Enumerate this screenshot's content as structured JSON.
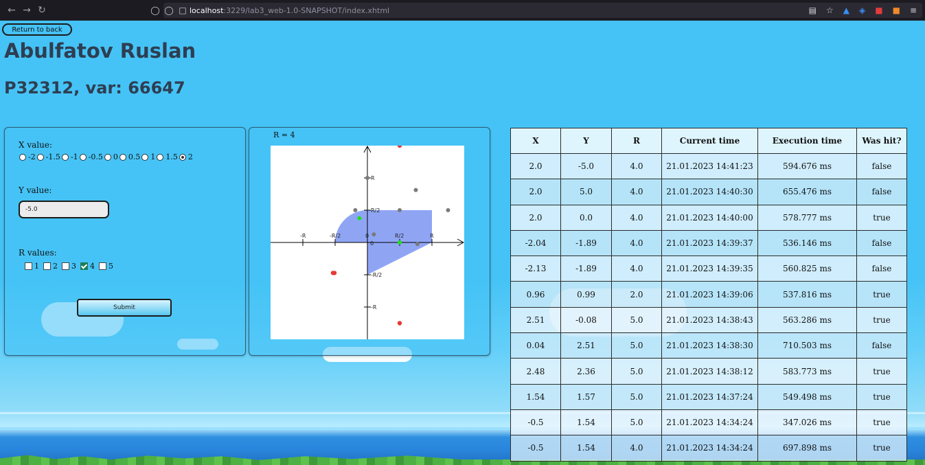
{
  "browser": {
    "url_host": "localhost",
    "url_path": ":3229/lab3_web-1.0-SNAPSHOT/index.xhtml"
  },
  "page": {
    "back_button": "Return to back",
    "author": "Abulfatov Ruslan",
    "group": "P32312, var: 66647"
  },
  "form": {
    "x_label": "X value:",
    "x_options": [
      "-2",
      "-1.5",
      "-1",
      "-0.5",
      "0",
      "0.5",
      "1",
      "1.5",
      "2"
    ],
    "x_selected": "2",
    "y_label": "Y value:",
    "y_value": "-5.0",
    "r_label": "R values:",
    "r_options": [
      "1",
      "2",
      "3",
      "4",
      "5"
    ],
    "r_checked": [
      "4"
    ],
    "submit_label": "Submit"
  },
  "graph": {
    "r_caption": "R = 4",
    "axis_labels": {
      "neg_r": "-R",
      "neg_half": "-R/2",
      "zero_x": "0",
      "half": "R/2",
      "r": "R",
      "y_r": "R",
      "y_half": "R/2",
      "zero_y": "0",
      "y_neg_half": "-R/2",
      "y_neg_r": "-R"
    },
    "area_color": "#8fa5f4",
    "points_r": 4,
    "points": [
      {
        "x": 2.0,
        "y": 6.0,
        "color": "red"
      },
      {
        "x": 0.0,
        "y": 4.0,
        "color": "gray"
      },
      {
        "x": 3.0,
        "y": 3.25,
        "color": "gray"
      },
      {
        "x": -0.75,
        "y": 2.0,
        "color": "gray"
      },
      {
        "x": 2.0,
        "y": 2.0,
        "color": "gray"
      },
      {
        "x": 5.0,
        "y": 2.0,
        "color": "gray"
      },
      {
        "x": -0.5,
        "y": 1.5,
        "color": "green"
      },
      {
        "x": 0.4,
        "y": 0.5,
        "color": "gray"
      },
      {
        "x": 2.0,
        "y": 0.0,
        "color": "green"
      },
      {
        "x": 3.1,
        "y": -0.1,
        "color": "gray"
      },
      {
        "x": -2.13,
        "y": -1.89,
        "color": "red"
      },
      {
        "x": -2.04,
        "y": -1.89,
        "color": "red"
      },
      {
        "x": 2.0,
        "y": -5.0,
        "color": "red"
      }
    ],
    "colors": {
      "red": "#e53935",
      "gray": "#7a7a7a",
      "green": "#22dd22"
    }
  },
  "table": {
    "headers": [
      "X",
      "Y",
      "R",
      "Current time",
      "Execution time",
      "Was hit?"
    ],
    "rows": [
      [
        "2.0",
        "-5.0",
        "4.0",
        "21.01.2023 14:41:23",
        "594.676 ms",
        "false"
      ],
      [
        "2.0",
        "5.0",
        "4.0",
        "21.01.2023 14:40:30",
        "655.476 ms",
        "false"
      ],
      [
        "2.0",
        "0.0",
        "4.0",
        "21.01.2023 14:40:00",
        "578.777 ms",
        "true"
      ],
      [
        "-2.04",
        "-1.89",
        "4.0",
        "21.01.2023 14:39:37",
        "536.146 ms",
        "false"
      ],
      [
        "-2.13",
        "-1.89",
        "4.0",
        "21.01.2023 14:39:35",
        "560.825 ms",
        "false"
      ],
      [
        "0.96",
        "0.99",
        "2.0",
        "21.01.2023 14:39:06",
        "537.816 ms",
        "true"
      ],
      [
        "2.51",
        "-0.08",
        "5.0",
        "21.01.2023 14:38:43",
        "563.286 ms",
        "true"
      ],
      [
        "0.04",
        "2.51",
        "5.0",
        "21.01.2023 14:38:30",
        "710.503 ms",
        "false"
      ],
      [
        "2.48",
        "2.36",
        "5.0",
        "21.01.2023 14:38:12",
        "583.773 ms",
        "true"
      ],
      [
        "1.54",
        "1.57",
        "5.0",
        "21.01.2023 14:37:24",
        "549.498 ms",
        "true"
      ],
      [
        "-0.5",
        "1.54",
        "5.0",
        "21.01.2023 14:34:24",
        "347.026 ms",
        "true"
      ],
      [
        "-0.5",
        "1.54",
        "4.0",
        "21.01.2023 14:34:24",
        "697.898 ms",
        "true"
      ]
    ]
  }
}
